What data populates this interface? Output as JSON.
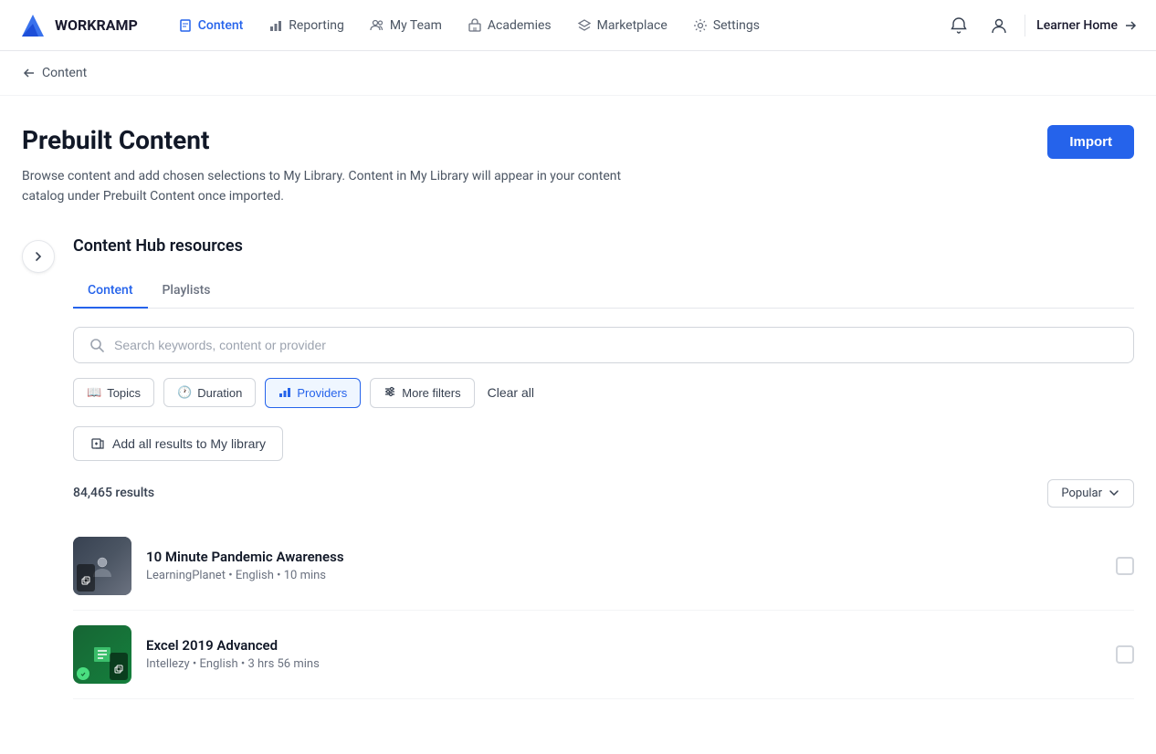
{
  "brand": {
    "name": "WORKRAMP"
  },
  "nav": {
    "items": [
      {
        "id": "content",
        "label": "Content",
        "active": true,
        "icon": "file-icon"
      },
      {
        "id": "reporting",
        "label": "Reporting",
        "active": false,
        "icon": "chart-icon"
      },
      {
        "id": "myteam",
        "label": "My Team",
        "active": false,
        "icon": "people-icon"
      },
      {
        "id": "academies",
        "label": "Academies",
        "active": false,
        "icon": "building-icon"
      },
      {
        "id": "marketplace",
        "label": "Marketplace",
        "active": false,
        "icon": "layers-icon"
      },
      {
        "id": "settings",
        "label": "Settings",
        "active": false,
        "icon": "gear-icon"
      }
    ],
    "learner_home": "Learner Home"
  },
  "breadcrumb": {
    "back_label": "Content"
  },
  "page": {
    "title": "Prebuilt Content",
    "description": "Browse content and add chosen selections to My Library. Content in My Library will appear in your content catalog under Prebuilt Content once imported.",
    "import_button": "Import"
  },
  "hub": {
    "title": "Content Hub resources",
    "sidebar_toggle_aria": "Toggle sidebar"
  },
  "tabs": [
    {
      "id": "content",
      "label": "Content",
      "active": true
    },
    {
      "id": "playlists",
      "label": "Playlists",
      "active": false
    }
  ],
  "search": {
    "placeholder": "Search keywords, content or provider"
  },
  "filters": [
    {
      "id": "topics",
      "label": "Topics",
      "active": false,
      "icon": "📖"
    },
    {
      "id": "duration",
      "label": "Duration",
      "active": false,
      "icon": "🕐"
    },
    {
      "id": "providers",
      "label": "Providers",
      "active": true,
      "icon": "📊"
    },
    {
      "id": "more-filters",
      "label": "More filters",
      "active": false,
      "icon": "⚙️"
    }
  ],
  "clear_all": "Clear all",
  "add_library_button": "Add all results to My library",
  "results": {
    "count": "84,465 results",
    "sort": "Popular"
  },
  "content_items": [
    {
      "id": 1,
      "title": "10 Minute Pandemic Awareness",
      "provider": "LearningPlanet",
      "language": "English",
      "duration": "10 mins",
      "thumb_type": "pandemic"
    },
    {
      "id": 2,
      "title": "Excel 2019 Advanced",
      "provider": "Intellezy",
      "language": "English",
      "duration": "3 hrs 56 mins",
      "thumb_type": "excel"
    }
  ]
}
